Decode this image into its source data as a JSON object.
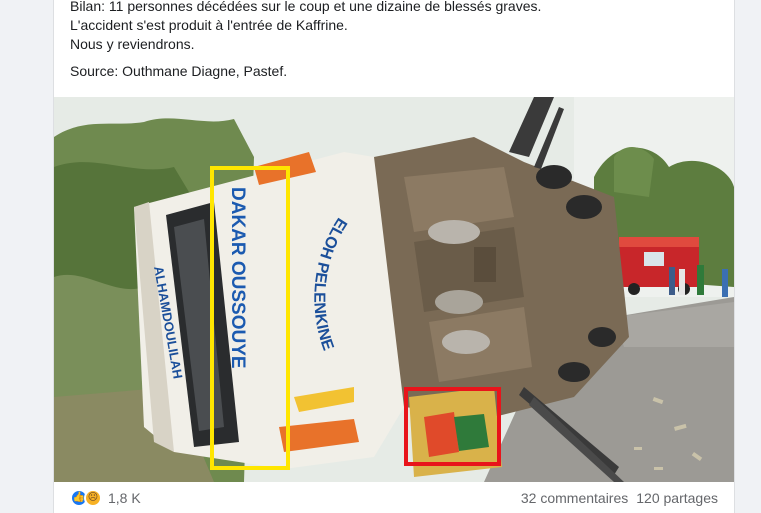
{
  "post": {
    "lines": [
      "Bilan: 11 personnes décédées sur le coup et une dizaine de blessés graves.",
      "L'accident s'est produit à l'entrée de Kaffrine.",
      "Nous y reviendrons."
    ],
    "source": "Source: Outhmane Diagne, Pastef."
  },
  "photo": {
    "bus_texts": {
      "side": "ALHAMDOULILAH",
      "route": "DAKAR OUSSOUYE",
      "arc": "ELOH PELENKINE"
    },
    "highlights": {
      "yellow_color": "#ffe600",
      "red_color": "#e8141b"
    }
  },
  "footer": {
    "reaction_icons": [
      "like-icon",
      "sad-icon"
    ],
    "reaction_count": "1,8 K",
    "comments": "32 commentaires",
    "shares": "120 partages"
  },
  "colors": {
    "text": "#1c1e21",
    "secondary": "#65676b",
    "like_blue": "#1877f2",
    "background": "#f0f2f5"
  }
}
